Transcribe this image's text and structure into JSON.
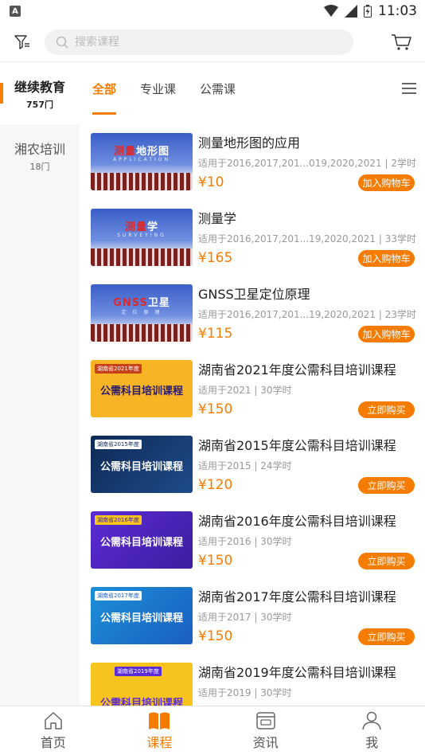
{
  "status_bar": {
    "time": "11:03",
    "notification_icon": "A"
  },
  "header": {
    "search_placeholder": "搜索课程"
  },
  "sidebar": {
    "items": [
      {
        "name": "继续教育",
        "count": "757门",
        "active": true
      },
      {
        "name": "湘农培训",
        "count": "18门",
        "active": false
      }
    ]
  },
  "tabs": {
    "items": [
      "全部",
      "专业课",
      "公需课"
    ],
    "active": "全部"
  },
  "courses": [
    {
      "title": "测量地形图的应用",
      "meta": "适用于2016,2017,201...019,2020,2021 | 2学时",
      "price": "¥10",
      "button": "加入购物车",
      "thumb": {
        "style": "blue",
        "head_red": "测量",
        "head_white": "地形图",
        "sub": "APPLICATION"
      }
    },
    {
      "title": "测量学",
      "meta": "适用于2016,2017,201...19,2020,2021 | 33学时",
      "price": "¥165",
      "button": "加入购物车",
      "thumb": {
        "style": "blue",
        "head_red": "测量",
        "head_white": "学",
        "sub": "SURVEYING"
      }
    },
    {
      "title": "GNSS卫星定位原理",
      "meta": "适用于2016,2017,201...19,2020,2021 | 23学时",
      "price": "¥115",
      "button": "加入购物车",
      "thumb": {
        "style": "blue",
        "head_red": "GNSS",
        "head_white": "卫星",
        "sub": "定 位 原 理"
      }
    },
    {
      "title": "湖南省2021年度公需科目培训课程",
      "meta": "适用于2021 | 30学时",
      "price": "¥150",
      "button": "立即购买",
      "thumb": {
        "style": "yellow",
        "tag": "湖南省2021年度",
        "text": "公需科目培训课程"
      }
    },
    {
      "title": "湖南省2015年度公需科目培训课程",
      "meta": "适用于2015 | 24学时",
      "price": "¥120",
      "button": "立即购买",
      "thumb": {
        "style": "navy",
        "tag": "湖南省2015年度",
        "text": "公需科目培训课程"
      }
    },
    {
      "title": "湖南省2016年度公需科目培训课程",
      "meta": "适用于2016 | 30学时",
      "price": "¥150",
      "button": "立即购买",
      "thumb": {
        "style": "purple",
        "tag": "湖南省2016年度",
        "text": "公需科目培训课程"
      }
    },
    {
      "title": "湖南省2017年度公需科目培训课程",
      "meta": "适用于2017 | 30学时",
      "price": "¥150",
      "button": "立即购买",
      "thumb": {
        "style": "cyan",
        "tag": "湖南省2017年度",
        "text": "公需科目培训课程"
      }
    },
    {
      "title": "湖南省2019年度公需科目培训课程",
      "meta": "适用于2019 | 30学时",
      "price": "",
      "button": "",
      "thumb": {
        "style": "yellow2",
        "tag": "湖南省2019年度",
        "text": "公需科目培训课程"
      }
    }
  ],
  "bottom_nav": {
    "items": [
      {
        "label": "首页",
        "icon": "home-icon",
        "active": false
      },
      {
        "label": "课程",
        "icon": "book-icon",
        "active": true
      },
      {
        "label": "资讯",
        "icon": "news-icon",
        "active": false
      },
      {
        "label": "我",
        "icon": "user-icon",
        "active": false
      }
    ]
  },
  "colors": {
    "accent": "#f57c00",
    "text": "#222222",
    "muted": "#999999"
  }
}
